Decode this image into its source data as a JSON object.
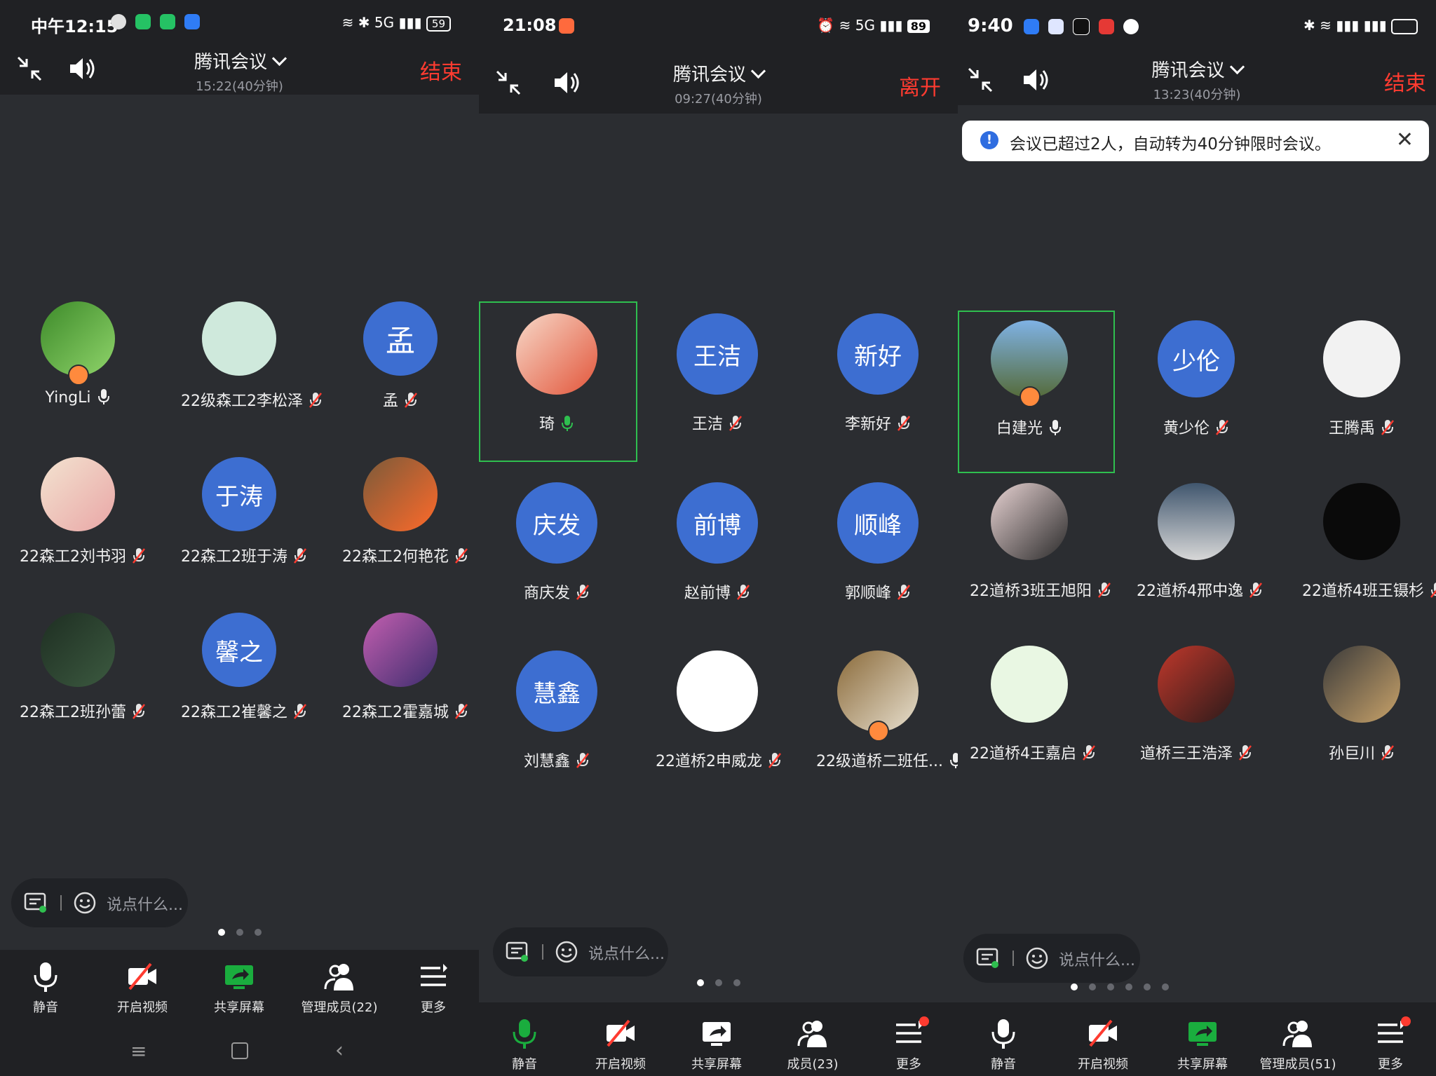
{
  "colors": {
    "accent_blue": "#3d6ed1",
    "end_red": "#ff3b30",
    "selection_green": "#2fbf4f",
    "share_green": "#1aad3e",
    "host_orange": "#ff8a3d"
  },
  "panel1": {
    "status": {
      "time": "中午12:15",
      "battery": "59",
      "net": "5G"
    },
    "title": "腾讯会议",
    "subtitle": "15:22(40分钟)",
    "end_label": "结束",
    "participants": [
      {
        "name": "YingLi",
        "avatar_text": "",
        "mic": "on"
      },
      {
        "name": "22级森工2李松泽",
        "avatar_text": "",
        "mic": "off"
      },
      {
        "name": "孟",
        "avatar_text": "孟",
        "mic": "off"
      },
      {
        "name": "22森工2刘书羽",
        "avatar_text": "",
        "mic": "off"
      },
      {
        "name": "22森工2班于涛",
        "avatar_text": "于涛",
        "mic": "off"
      },
      {
        "name": "22森工2何艳花",
        "avatar_text": "",
        "mic": "off"
      },
      {
        "name": "22森工2班孙蕾",
        "avatar_text": "",
        "mic": "off"
      },
      {
        "name": "22森工2崔馨之",
        "avatar_text": "馨之",
        "mic": "off"
      },
      {
        "name": "22森工2霍嘉城",
        "avatar_text": "",
        "mic": "off"
      }
    ],
    "chat_placeholder": "说点什么...",
    "toolbar": {
      "mute": "静音",
      "video": "开启视频",
      "share": "共享屏幕",
      "members": "管理成员(22)",
      "more": "更多"
    }
  },
  "panel2": {
    "status": {
      "time": "21:08",
      "battery": "89",
      "net": "5G"
    },
    "title": "腾讯会议",
    "subtitle": "09:27(40分钟)",
    "end_label": "离开",
    "participants": [
      {
        "name": "琦",
        "avatar_text": "",
        "mic": "speaking"
      },
      {
        "name": "王洁",
        "avatar_text": "王洁",
        "mic": "off"
      },
      {
        "name": "李新好",
        "avatar_text": "新好",
        "mic": "off"
      },
      {
        "name": "商庆发",
        "avatar_text": "庆发",
        "mic": "off"
      },
      {
        "name": "赵前博",
        "avatar_text": "前博",
        "mic": "off"
      },
      {
        "name": "郭顺峰",
        "avatar_text": "顺峰",
        "mic": "off"
      },
      {
        "name": "刘慧鑫",
        "avatar_text": "慧鑫",
        "mic": "off"
      },
      {
        "name": "22道桥2申威龙",
        "avatar_text": "",
        "mic": "off"
      },
      {
        "name": "22级道桥二班任...",
        "avatar_text": "",
        "mic": "on"
      }
    ],
    "chat_placeholder": "说点什么...",
    "toolbar": {
      "mute": "静音",
      "video": "开启视频",
      "share": "共享屏幕",
      "members": "成员(23)",
      "more": "更多"
    }
  },
  "panel3": {
    "status": {
      "time": "9:40"
    },
    "title": "腾讯会议",
    "subtitle": "13:23(40分钟)",
    "end_label": "结束",
    "notice": "会议已超过2人，自动转为40分钟限时会议。",
    "participants": [
      {
        "name": "白建光",
        "avatar_text": "",
        "mic": "on"
      },
      {
        "name": "黄少伦",
        "avatar_text": "少伦",
        "mic": "off"
      },
      {
        "name": "王腾禹",
        "avatar_text": "",
        "mic": "off"
      },
      {
        "name": "22道桥3班王旭阳",
        "avatar_text": "",
        "mic": "off"
      },
      {
        "name": "22道桥4邢中逸",
        "avatar_text": "",
        "mic": "off"
      },
      {
        "name": "22道桥4班王镊杉",
        "avatar_text": "",
        "mic": "off"
      },
      {
        "name": "22道桥4王嘉启",
        "avatar_text": "",
        "mic": "off"
      },
      {
        "name": "道桥三王浩泽",
        "avatar_text": "",
        "mic": "off"
      },
      {
        "name": "孙巨川",
        "avatar_text": "",
        "mic": "off"
      }
    ],
    "chat_placeholder": "说点什么...",
    "toolbar": {
      "mute": "静音",
      "video": "开启视频",
      "share": "共享屏幕",
      "members": "管理成员(51)",
      "more": "更多"
    }
  }
}
